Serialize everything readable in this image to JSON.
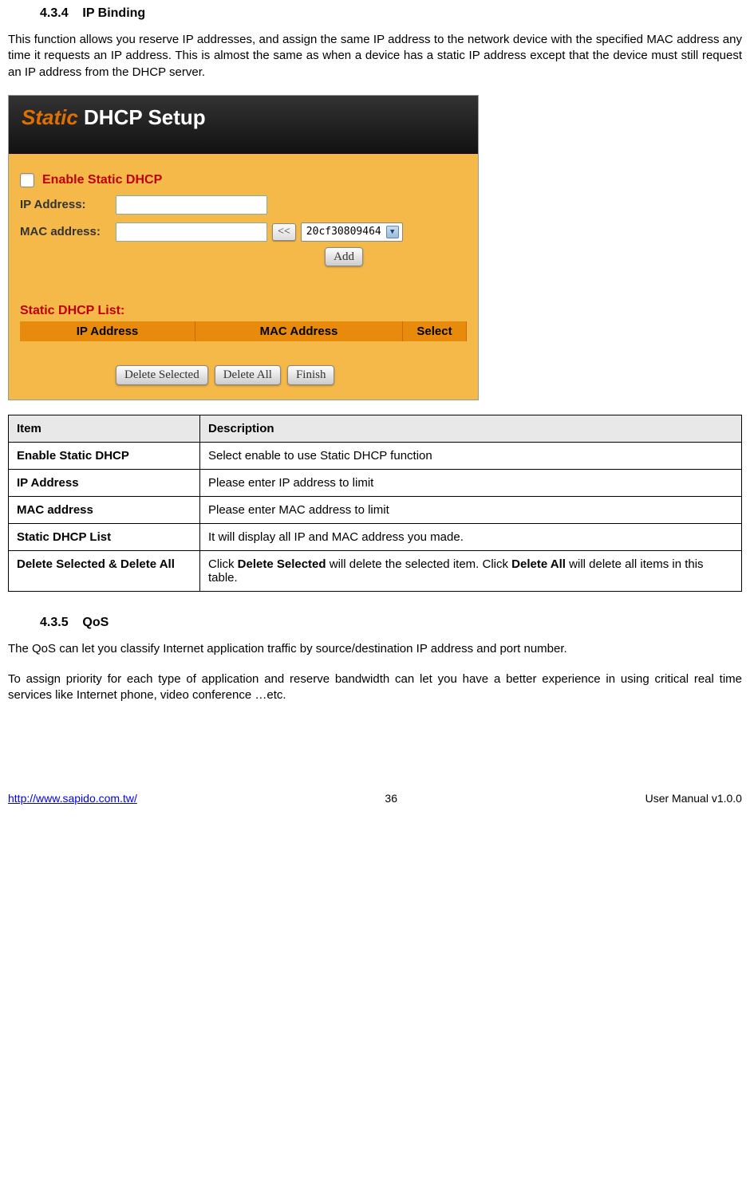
{
  "section1": {
    "number": "4.3.4",
    "title": "IP Binding",
    "para": "This function allows you reserve IP addresses, and assign the same IP address to the network device with the specified MAC address any time it requests an IP address. This is almost the same as when a device has a static IP address except that the device must still request an IP address from the DHCP server."
  },
  "screenshot": {
    "banner_prefix": "Static ",
    "banner_rest": "DHCP Setup",
    "enable_label": "Enable Static DHCP",
    "ip_label": "IP Address:",
    "mac_label": "MAC address:",
    "arrow_btn": "<<",
    "dropdown_value": "20cf30809464",
    "add_btn": "Add",
    "list_title": "Static DHCP List:",
    "col1": "IP Address",
    "col2": "MAC Address",
    "col3": "Select",
    "btn_del_sel": "Delete Selected",
    "btn_del_all": "Delete All",
    "btn_finish": "Finish"
  },
  "table": {
    "h1": "Item",
    "h2": "Description",
    "rows": [
      {
        "item": "Enable Static DHCP",
        "desc": "Select enable to use Static DHCP function"
      },
      {
        "item": "IP Address",
        "desc": "Please enter IP address to limit"
      },
      {
        "item": "MAC address",
        "desc": "Please enter MAC address to limit"
      },
      {
        "item": "Static DHCP List",
        "desc": "It will display all IP and MAC address you made.",
        "bold": true
      },
      {
        "item": "Delete Selected & Delete All",
        "desc_prefix": "Click ",
        "desc_b1": "Delete Selected",
        "desc_mid": " will delete the selected item. Click ",
        "desc_b2": "Delete All",
        "desc_suffix": " will delete all items in this table."
      }
    ]
  },
  "section2": {
    "number": "4.3.5",
    "title": "QoS",
    "para1": "The QoS can let you classify Internet application traffic by source/destination IP address and port number.",
    "para2": "To assign priority for each type of application and reserve bandwidth can let you have a better experience in using critical real time services like Internet phone, video conference …etc."
  },
  "footer": {
    "url": "http://www.sapido.com.tw/",
    "page": "36",
    "right": "User  Manual  v1.0.0"
  }
}
